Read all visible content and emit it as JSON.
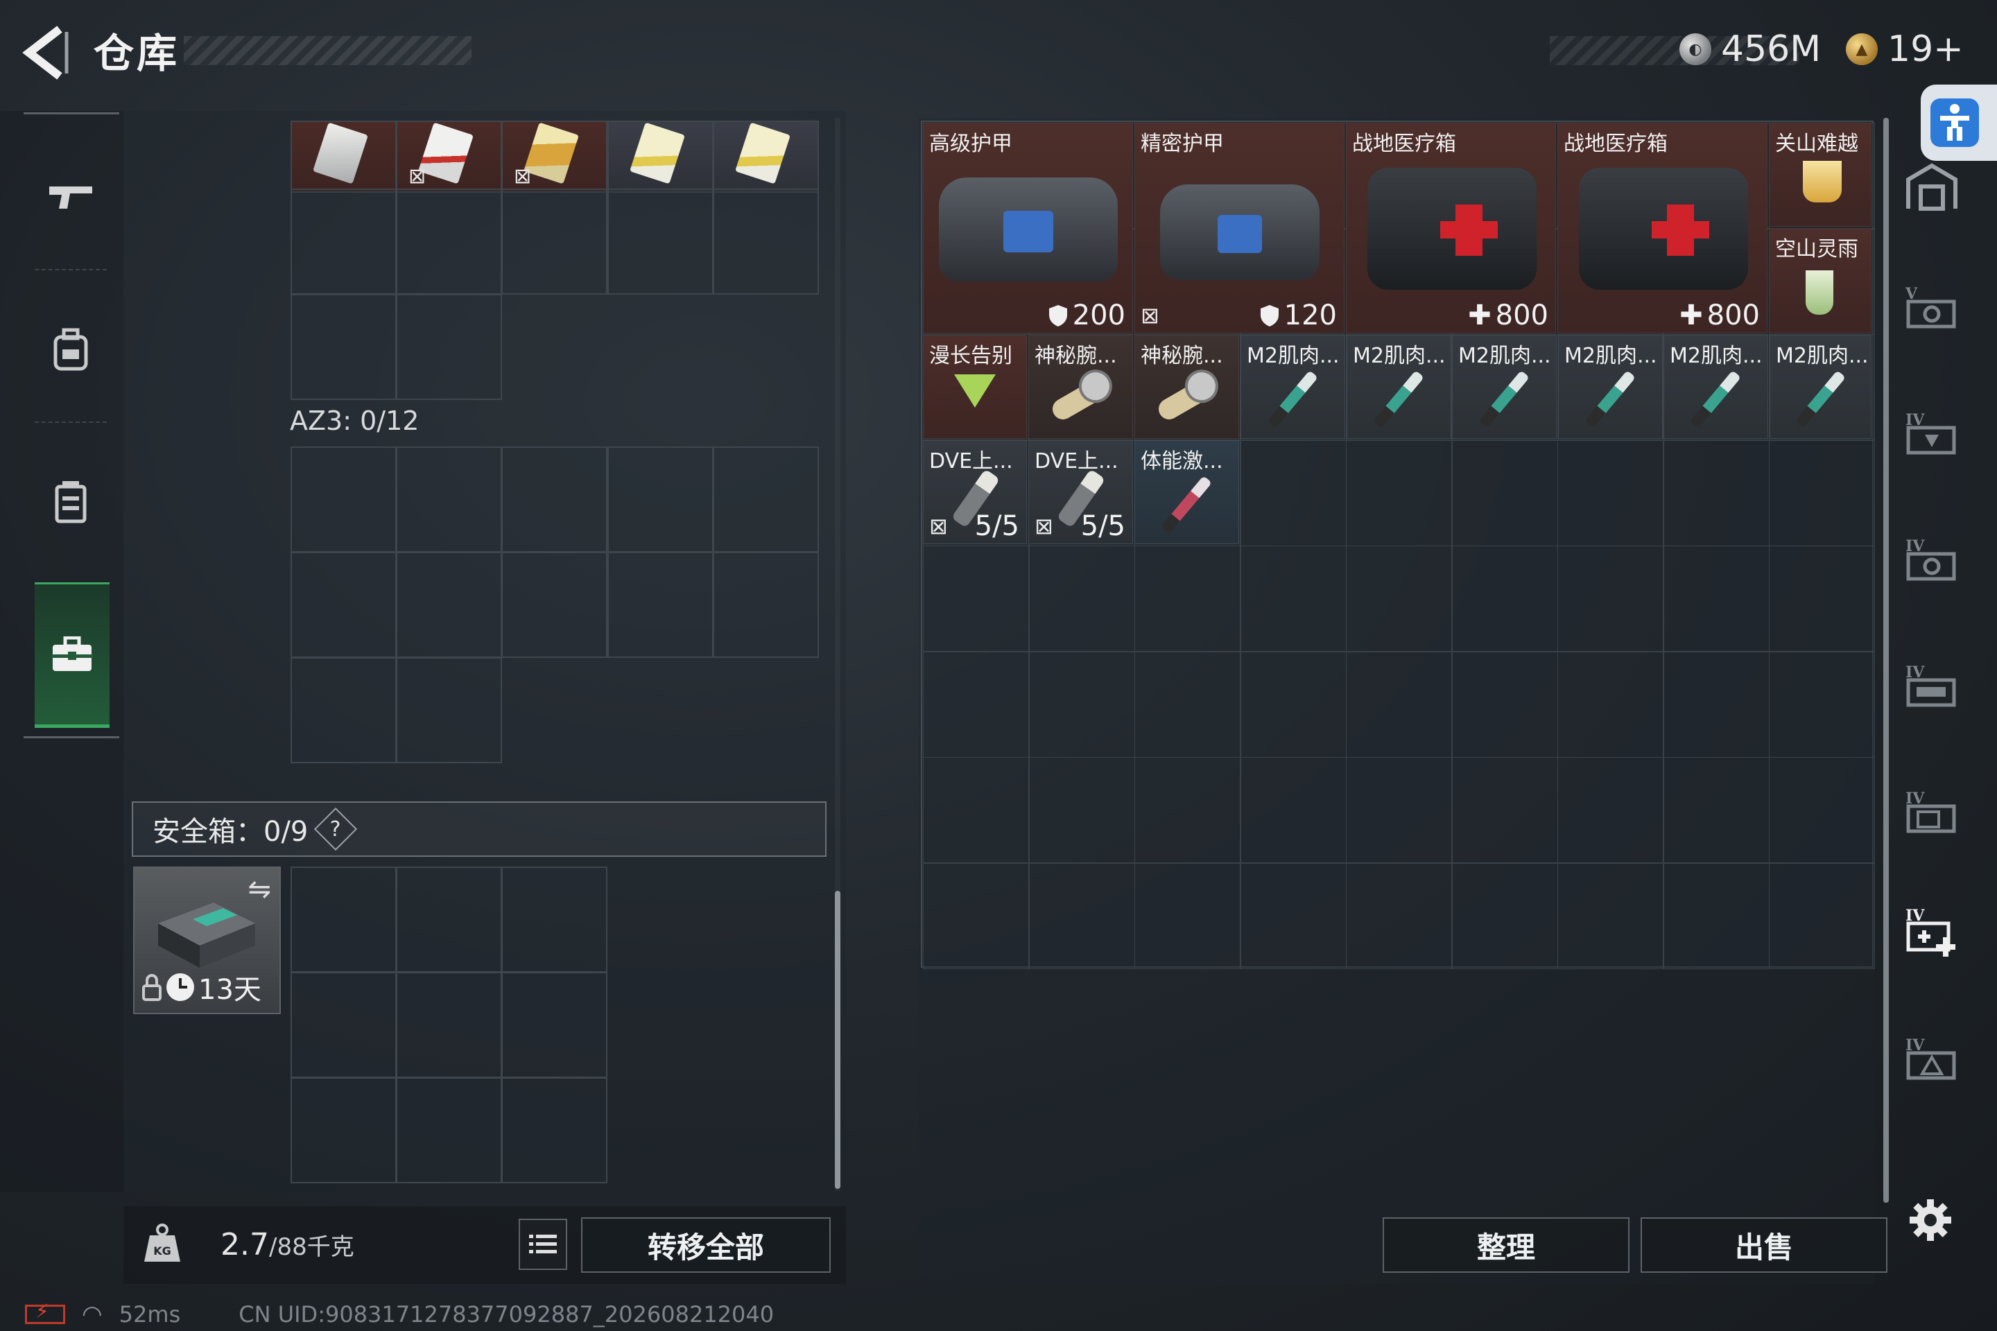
{
  "header": {
    "title": "仓库"
  },
  "currencies": [
    {
      "icon": "silver-coin-icon",
      "value": "456M"
    },
    {
      "icon": "gold-coin-icon",
      "value": "19+"
    }
  ],
  "left_rail": {
    "tabs": [
      "gun-icon",
      "backpack-icon",
      "vest-icon",
      "safebox-tab-icon"
    ],
    "active_index": 3
  },
  "container": {
    "label": "AZ3: 0/12",
    "cards_nomark": "⊠"
  },
  "safebox": {
    "label": "安全箱：0/9",
    "help": "?",
    "item_duration": "13天"
  },
  "weight": {
    "current": "2.7",
    "max": "/88千克"
  },
  "buttons": {
    "transfer_all": "转移全部",
    "sort": "整理",
    "sell": "出售"
  },
  "items": [
    {
      "name": "高级护甲",
      "value": "200",
      "value_icon": "shield-icon"
    },
    {
      "name": "精密护甲",
      "value": "120",
      "value_icon": "shield-icon"
    },
    {
      "name": "战地医疗箱",
      "value": "800",
      "value_icon": "plus-icon"
    },
    {
      "name": "战地医疗箱",
      "value": "800",
      "value_icon": "plus-icon"
    },
    {
      "name": "关山难越"
    },
    {
      "name": "空山灵雨"
    },
    {
      "name": "漫长告别"
    },
    {
      "name": "神秘腕..."
    },
    {
      "name": "神秘腕..."
    },
    {
      "name": "M2肌肉..."
    },
    {
      "name": "M2肌肉..."
    },
    {
      "name": "M2肌肉..."
    },
    {
      "name": "M2肌肉..."
    },
    {
      "name": "M2肌肉..."
    },
    {
      "name": "M2肌肉..."
    },
    {
      "name": "DVE上...",
      "value": "5/5"
    },
    {
      "name": "DVE上...",
      "value": "5/5"
    },
    {
      "name": "体能激..."
    }
  ],
  "status_bar": {
    "ping": "52ms",
    "uid": "CN UID:9083171278377092887_202608212040"
  },
  "colors": {
    "accent_green": "#3aa860",
    "item_red_bg": "#4d2e2a",
    "item_blue_bg": "#2f3d48",
    "accessibility_blue": "#2c7bd8"
  }
}
